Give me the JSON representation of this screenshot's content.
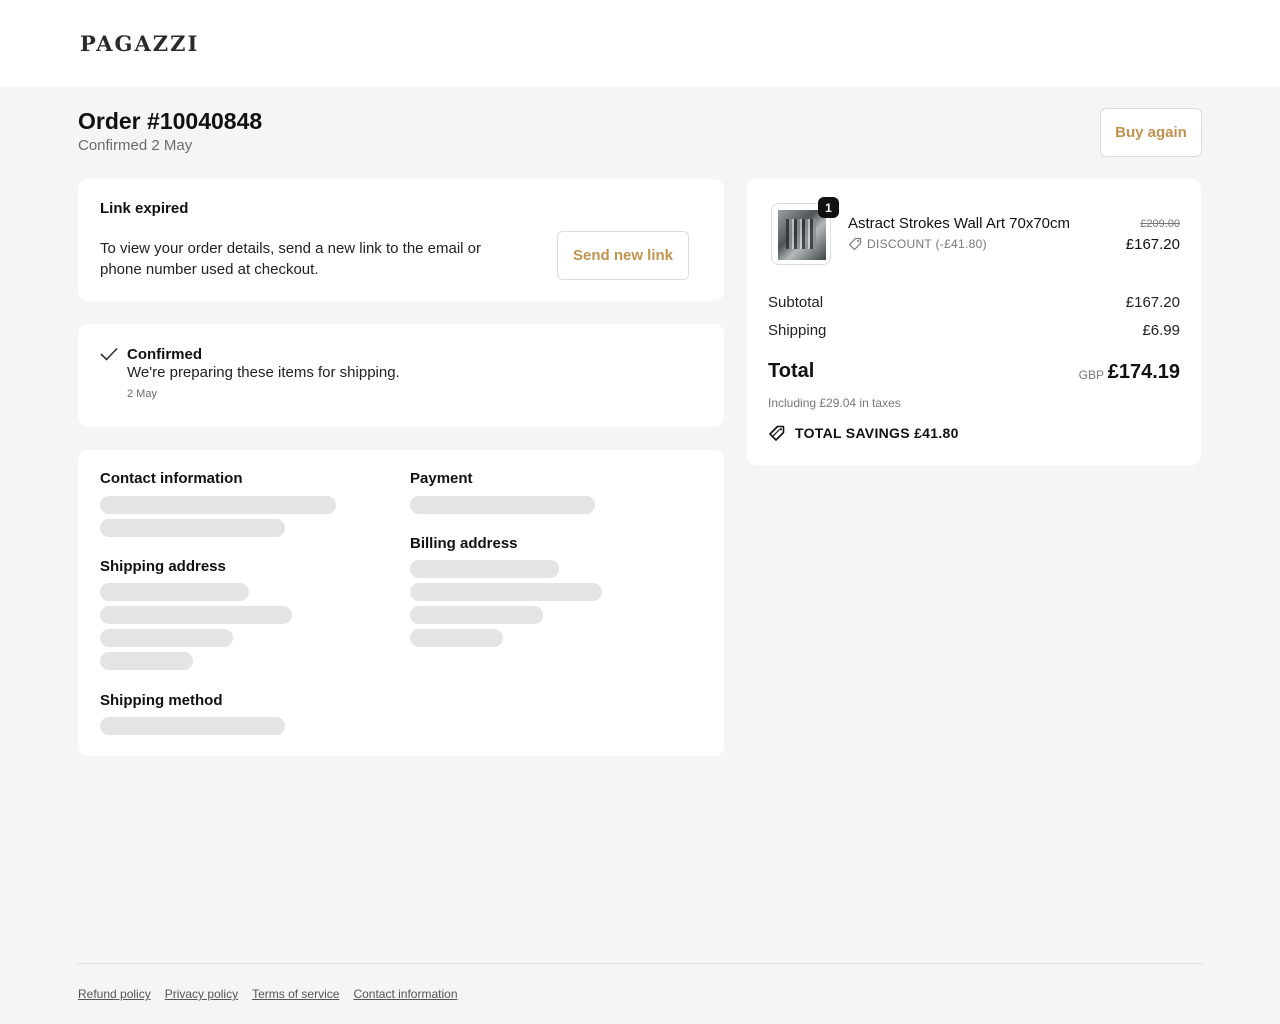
{
  "header": {
    "logo": "PAGAZZI"
  },
  "order": {
    "title": "Order #10040848",
    "subtitle": "Confirmed 2 May",
    "buy_again_label": "Buy again"
  },
  "link_card": {
    "heading": "Link expired",
    "text": "To view your order details, send a new link to the email or phone number used at checkout.",
    "button_label": "Send new link"
  },
  "status_card": {
    "title": "Confirmed",
    "text": "We're preparing these items for shipping.",
    "date": "2 May"
  },
  "info_card": {
    "contact_heading": "Contact information",
    "payment_heading": "Payment",
    "shipping_address_heading": "Shipping address",
    "billing_address_heading": "Billing address",
    "shipping_method_heading": "Shipping method"
  },
  "summary": {
    "item": {
      "quantity": "1",
      "name": "Astract Strokes Wall Art 70x70cm",
      "discount": "DISCOUNT (-£41.80)",
      "original_price": "£209.00",
      "price": "£167.20"
    },
    "subtotal_label": "Subtotal",
    "subtotal_value": "£167.20",
    "shipping_label": "Shipping",
    "shipping_value": "£6.99",
    "total_label": "Total",
    "currency": "GBP",
    "total_value": "£174.19",
    "tax_note": "Including £29.04 in taxes",
    "savings": "TOTAL SAVINGS £41.80"
  },
  "footer": {
    "links": [
      "Refund policy",
      "Privacy policy",
      "Terms of service",
      "Contact information"
    ]
  },
  "colors": {
    "accent": "#c2934f",
    "background": "#f5f5f5",
    "skeleton": "#e4e4e4"
  }
}
